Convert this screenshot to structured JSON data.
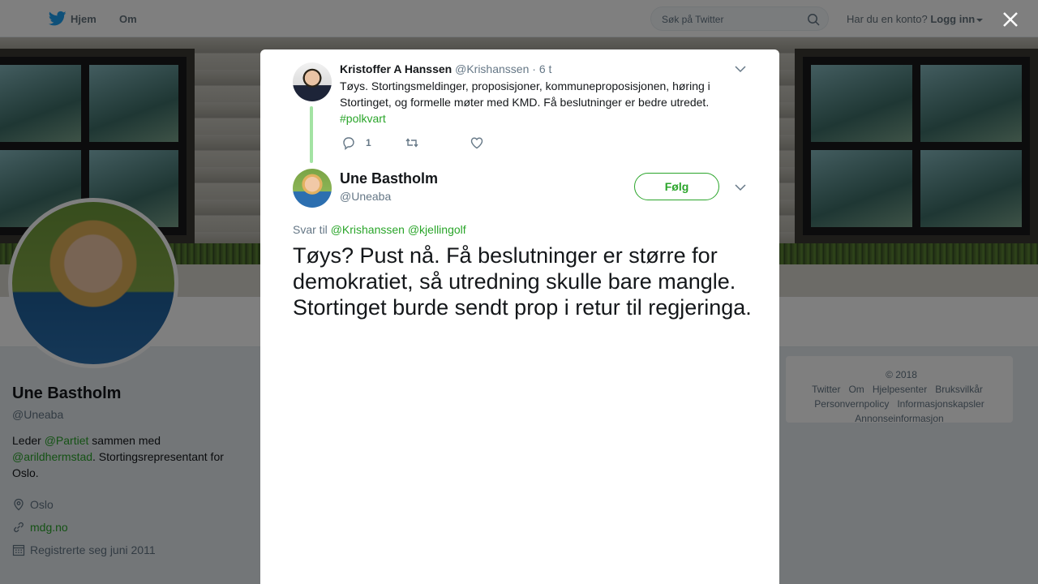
{
  "nav": {
    "home_label": "Hjem",
    "about_label": "Om",
    "search_placeholder": "Søk på Twitter",
    "have_account": "Har du en konto?",
    "login_label": "Logg inn"
  },
  "profile": {
    "name": "Une Bastholm",
    "handle": "@Uneaba",
    "bio_prefix": "Leder",
    "bio_mention1": "@Partiet",
    "bio_mid": "sammen med",
    "bio_mention2": "@arildhermstad",
    "bio_suffix": ". Stortingsrepresentant for Oslo.",
    "location": "Oslo",
    "website": "mdg.no",
    "joined": "Registrerte seg juni 2011"
  },
  "footer": {
    "links": [
      "© 2018 Twitter",
      "Om",
      "Hjelpesenter",
      "Bruksvilkår",
      "Personvernpolicy",
      "Informasjonskapsler",
      "Annonseinformasjon"
    ]
  },
  "modal": {
    "parent": {
      "name": "Kristoffer A Hanssen",
      "handle": "@Krishanssen",
      "time": "· 6 t",
      "text": "Tøys. Stortingsmeldinger, proposisjoner, kommuneproposisjonen, høring i Stortinget, og formelle møter med KMD. Få beslutninger er bedre utredet.",
      "hashtag": "#polkvart",
      "reply_count": "1"
    },
    "main": {
      "name": "Une Bastholm",
      "handle": "@Uneaba",
      "follow_label": "Følg",
      "reply_prefix": "Svar til",
      "reply_mention1": "@Krishanssen",
      "reply_mention2": "@kjellingolf",
      "text": "Tøys? Pust nå. Få beslutninger er større for demokratiet, så utredning skulle bare mangle. Stortinget burde sendt prop i retur til regjeringa."
    }
  },
  "colors": {
    "accent": "#2aa52a",
    "thread_line": "#a3e3a3"
  }
}
